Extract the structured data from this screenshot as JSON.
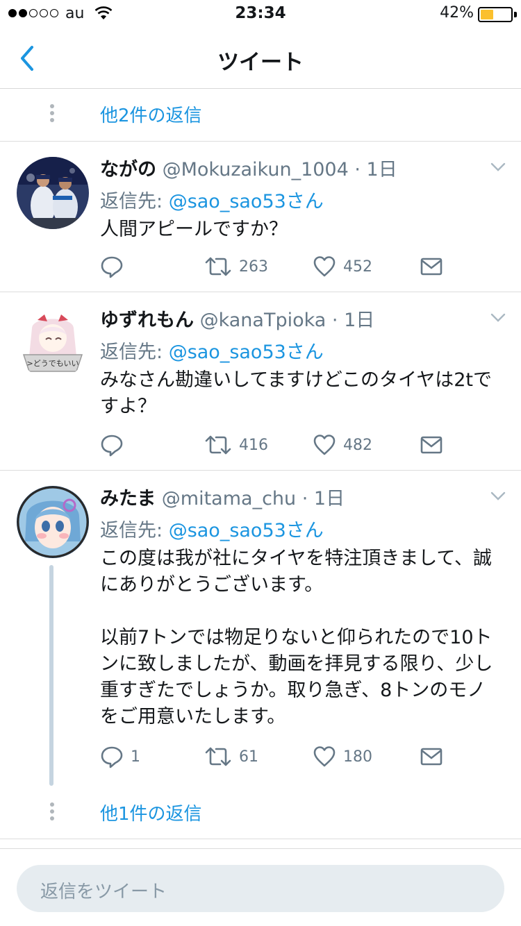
{
  "status_bar": {
    "carrier": "au",
    "time": "23:34",
    "battery": "42%",
    "battery_level": 0.42,
    "signal_bars": 2
  },
  "nav": {
    "title": "ツイート",
    "back_icon": "chevron-left-icon"
  },
  "thread_top": {
    "more_replies": "他2件の返信"
  },
  "tweets": [
    {
      "name": "ながの",
      "handle": "@Mokuzaikun_1004",
      "time": "· 1日",
      "reply_label": "返信先: ",
      "reply_to": "@sao_sao53さん",
      "text": "人間アピールですか？",
      "replies": "",
      "retweets": "263",
      "likes": "452"
    },
    {
      "name": "ゆずれもん",
      "handle": "@kanaTpioka",
      "time": "· 1日",
      "reply_label": "返信先: ",
      "reply_to": "@sao_sao53さん",
      "text": "みなさん勘違いしてますけどこのタイヤは2tですよ？",
      "replies": "",
      "retweets": "416",
      "likes": "482",
      "avatar_caption": ">どうでもいい"
    },
    {
      "name": "みたま",
      "handle": "@mitama_chu",
      "time": "· 1日",
      "reply_label": "返信先: ",
      "reply_to": "@sao_sao53さん",
      "text": "この度は我が社にタイヤを特注頂きまして、誠にありがとうございます。\n\n以前7トンでは物足りないと仰られたので10トンに致しましたが、動画を拝見する限り、少し重すぎたでしょうか。取り急ぎ、8トンのモノをご用意いたします。",
      "replies": "1",
      "retweets": "61",
      "likes": "180"
    }
  ],
  "thread_bottom": {
    "more_replies": "他1件の返信"
  },
  "composer": {
    "placeholder": "返信をツイート"
  },
  "colors": {
    "accent": "#1b95e0",
    "secondary_text": "#657786",
    "icon": "#657786",
    "composer_bg": "#e6ecf0",
    "battery": "#fbc02d"
  }
}
